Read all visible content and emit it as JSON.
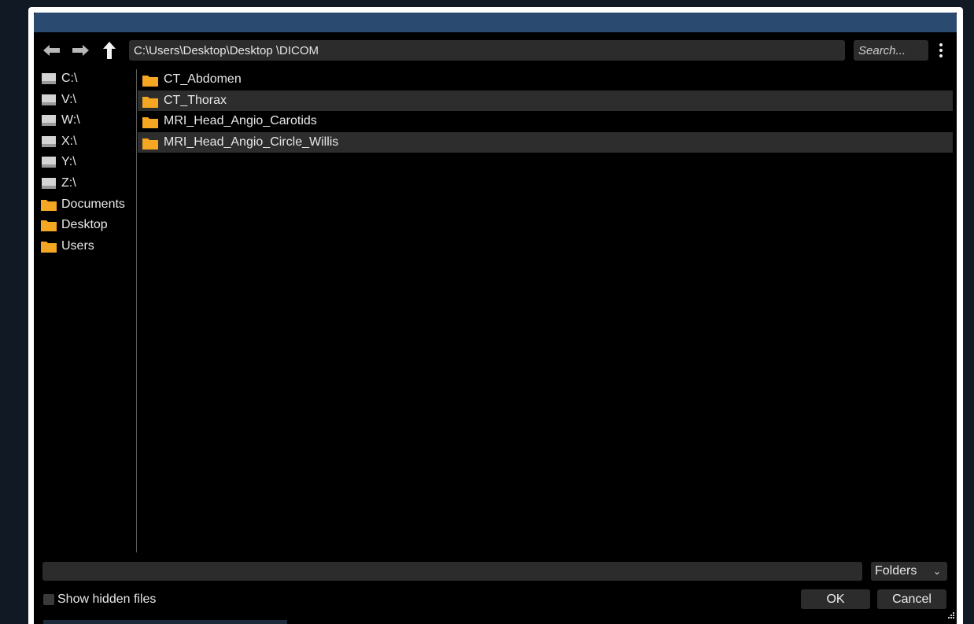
{
  "toolbar": {
    "back_icon": "back-arrow-icon",
    "forward_icon": "forward-arrow-icon",
    "up_icon": "up-arrow-icon",
    "path": "C:\\Users\\Desktop\\Desktop \\DICOM",
    "search_placeholder": "Search...",
    "menu_icon": "kebab-menu-icon"
  },
  "sidebar": {
    "items": [
      {
        "label": "C:\\",
        "icon": "drive-icon"
      },
      {
        "label": "V:\\",
        "icon": "drive-icon"
      },
      {
        "label": "W:\\",
        "icon": "drive-icon"
      },
      {
        "label": "X:\\",
        "icon": "drive-icon"
      },
      {
        "label": "Y:\\",
        "icon": "drive-icon"
      },
      {
        "label": "Z:\\",
        "icon": "drive-icon"
      },
      {
        "label": "Documents",
        "icon": "folder-icon"
      },
      {
        "label": "Desktop",
        "icon": "folder-icon"
      },
      {
        "label": "Users",
        "icon": "folder-icon"
      }
    ]
  },
  "files": [
    {
      "name": "CT_Abdomen",
      "icon": "folder-icon",
      "selected": false
    },
    {
      "name": "CT_Thorax",
      "icon": "folder-icon",
      "selected": true
    },
    {
      "name": "MRI_Head_Angio_Carotids",
      "icon": "folder-icon",
      "selected": false
    },
    {
      "name": "MRI_Head_Angio_Circle_Willis",
      "icon": "folder-icon",
      "selected": true
    }
  ],
  "footer": {
    "filename_value": "",
    "filter_selected": "Folders",
    "show_hidden_label": "Show hidden files",
    "show_hidden_checked": false,
    "ok_label": "OK",
    "cancel_label": "Cancel"
  },
  "colors": {
    "titlebar": "#2b4a70",
    "folder": "#f5a623",
    "selection": "#2d2d2d",
    "background": "#000000"
  }
}
